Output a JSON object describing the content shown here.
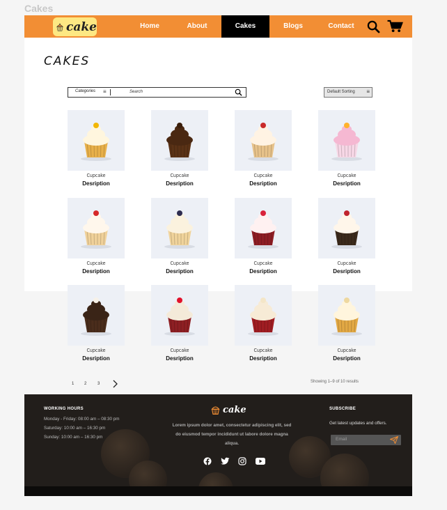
{
  "frame_title": "Cakes",
  "brand": {
    "name": "cake",
    "accent": "#f28e34",
    "logo_bg": "#fde883"
  },
  "nav": {
    "items": [
      {
        "label": "Home",
        "active": false
      },
      {
        "label": "About",
        "active": false
      },
      {
        "label": "Cakes",
        "active": true
      },
      {
        "label": "Blogs",
        "active": false
      },
      {
        "label": "Contact",
        "active": false
      }
    ],
    "icons": [
      "search-icon",
      "cart-icon"
    ]
  },
  "page_title": "CAKES",
  "search": {
    "category_label": "Categories",
    "placeholder": "Search"
  },
  "sort": {
    "label": "Default Sorting"
  },
  "products": [
    {
      "name": "Cupcake",
      "desc": "Desription"
    },
    {
      "name": "Cupcake",
      "desc": "Desription"
    },
    {
      "name": "Cupcake",
      "desc": "Desription"
    },
    {
      "name": "Cupcake",
      "desc": "Desription"
    },
    {
      "name": "Cupcake",
      "desc": "Desription"
    },
    {
      "name": "Cupcake",
      "desc": "Desription"
    },
    {
      "name": "Cupcake",
      "desc": "Desription"
    },
    {
      "name": "Cupcake",
      "desc": "Desription"
    },
    {
      "name": "Cupcake",
      "desc": "Desription"
    },
    {
      "name": "Cupcake",
      "desc": "Desription"
    },
    {
      "name": "Cupcake",
      "desc": "Desription"
    },
    {
      "name": "Cupcake",
      "desc": "Desription"
    }
  ],
  "pagination": {
    "pages": [
      "1",
      "2",
      "3"
    ],
    "next_icon": "chevron-right-icon"
  },
  "results_text": "Showing 1–9 of 10 results",
  "footer": {
    "hours_heading": "WORKING HOURS",
    "hours": [
      "Monday - Friday: 08:00 am – 08:30 pm",
      "Saturday: 10:00 am – 16:30 pm",
      "Sunday: 10:00 am – 16:30 pm"
    ],
    "logo_text": "cake",
    "lorem": "Lorem ipsum dolor amet, consectetur adipiscing elit, sed do eiusmod tempor incididunt ut labore dolore magna aliqua.",
    "social_icons": [
      "facebook-icon",
      "twitter-icon",
      "instagram-icon",
      "youtube-icon"
    ],
    "subscribe_heading": "SUBSCRIBE",
    "subscribe_text": "Get latest updates and offers.",
    "email_placeholder": "Email"
  }
}
